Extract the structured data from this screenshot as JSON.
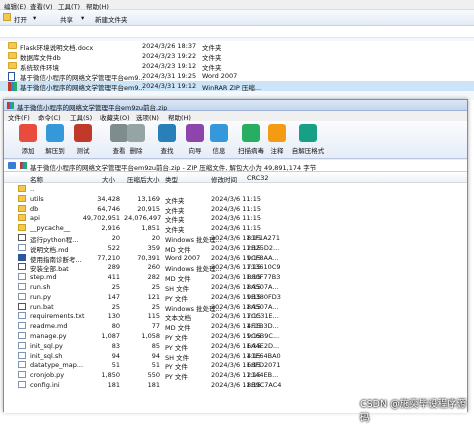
{
  "explorer": {
    "menu": [
      "编辑(E)",
      "查看(V)",
      "工具(T)",
      "帮助(H)"
    ],
    "toolbar": {
      "open": "打开",
      "share": "共享",
      "new_folder": "新建文件夹"
    },
    "rows": [
      {
        "name": "Flask环境说明文档.docx",
        "date": "2024/3/26 18:37",
        "type": "文件夹",
        "icon": "folder"
      },
      {
        "name": "数据库文件db",
        "date": "2024/3/23 19:22",
        "type": "文件夹",
        "icon": "folder"
      },
      {
        "name": "系统软件环境",
        "date": "2024/3/23 19:12",
        "type": "文件夹",
        "icon": "folder"
      },
      {
        "name": "基于微信小程序的网络文学管理平台em9...",
        "date": "2024/3/31 19:25",
        "type": "Word 2007",
        "icon": "word"
      },
      {
        "name": "基于微信小程序的网络文学管理平台em9...",
        "date": "2024/3/31 19:12",
        "type": "WinRAR ZIP 压缩...",
        "icon": "zip",
        "selected": true
      }
    ]
  },
  "rar": {
    "title": "基于微信小程序的网络文学管理平台em9zu前台.zip",
    "menu": [
      "文件(F)",
      "命令(C)",
      "工具(S)",
      "收藏夹(O)",
      "选项(N)",
      "帮助(H)"
    ],
    "toolbar": [
      {
        "label": "添加",
        "color": "#e74c3c"
      },
      {
        "label": "解压到",
        "color": "#3498db"
      },
      {
        "label": "测试",
        "color": "#c0392b"
      },
      {
        "label": "查看",
        "color": "#7f8c8d"
      },
      {
        "label": "删除",
        "color": "#95a5a6"
      },
      {
        "label": "查找",
        "color": "#2980b9"
      },
      {
        "label": "向导",
        "color": "#8e44ad"
      },
      {
        "label": "信息",
        "color": "#3498db"
      },
      {
        "label": "扫描病毒",
        "color": "#27ae60"
      },
      {
        "label": "注释",
        "color": "#f39c12"
      },
      {
        "label": "自解压格式",
        "color": "#16a085"
      }
    ],
    "path": "基于微信小程序的网络文学管理平台em9zu前台.zip - ZIP 压缩文件, 解包大小为 49,891,174 字节",
    "columns": {
      "name": "名称",
      "size": "大小",
      "packed": "压缩后大小",
      "type": "类型",
      "modified": "修改时间",
      "crc": "CRC32"
    },
    "rows": [
      {
        "name": "..",
        "size": "",
        "packed": "",
        "type": "",
        "modified": "",
        "crc": "",
        "icon": "folder"
      },
      {
        "name": "utils",
        "size": "34,428",
        "packed": "13,169",
        "type": "文件夹",
        "modified": "2024/3/6 11:15",
        "crc": "",
        "icon": "folder"
      },
      {
        "name": "db",
        "size": "64,746",
        "packed": "20,915",
        "type": "文件夹",
        "modified": "2024/3/6 11:15",
        "crc": "",
        "icon": "folder"
      },
      {
        "name": "api",
        "size": "49,702,951",
        "packed": "24,076,497",
        "type": "文件夹",
        "modified": "2024/3/6 11:15",
        "crc": "",
        "icon": "folder"
      },
      {
        "name": "__pycache__",
        "size": "2,916",
        "packed": "1,851",
        "type": "文件夹",
        "modified": "2024/3/6 11:15",
        "crc": "",
        "icon": "folder"
      },
      {
        "name": "运行python程...",
        "size": "20",
        "packed": "20",
        "type": "Windows 批处理...",
        "modified": "2024/3/6 11:15",
        "crc": "81F1A271",
        "icon": "bat"
      },
      {
        "name": "说明文档.md",
        "size": "522",
        "packed": "359",
        "type": "MD 文件",
        "modified": "2024/3/6 11:15",
        "crc": "2B25D2...",
        "icon": "doc"
      },
      {
        "name": "使用指南诊断考...",
        "size": "77,210",
        "packed": "70,391",
        "type": "Word 2007",
        "modified": "2024/3/6 11:15",
        "crc": "9CF8AA...",
        "icon": "word"
      },
      {
        "name": "安装全部.bat",
        "size": "289",
        "packed": "260",
        "type": "Windows 批处理...",
        "modified": "2024/3/6 11:15",
        "crc": "713610C9",
        "icon": "bat"
      },
      {
        "name": "step.md",
        "size": "411",
        "packed": "282",
        "type": "MD 文件",
        "modified": "2024/3/6 11:15",
        "crc": "B80F77B3",
        "icon": "doc"
      },
      {
        "name": "run.sh",
        "size": "25",
        "packed": "25",
        "type": "SH 文件",
        "modified": "2024/3/6 11:15",
        "crc": "8A507A...",
        "icon": "doc"
      },
      {
        "name": "run.py",
        "size": "147",
        "packed": "121",
        "type": "PY 文件",
        "modified": "2024/3/6 11:15",
        "crc": "9B380FD3",
        "icon": "doc"
      },
      {
        "name": "run.bat",
        "size": "25",
        "packed": "25",
        "type": "Windows 批处理...",
        "modified": "2024/3/6 11:15",
        "crc": "8A507A...",
        "icon": "bat"
      },
      {
        "name": "requirements.txt",
        "size": "130",
        "packed": "115",
        "type": "文本文档",
        "modified": "2024/3/6 11:15",
        "crc": "7CC31E...",
        "icon": "doc"
      },
      {
        "name": "readme.md",
        "size": "80",
        "packed": "77",
        "type": "MD 文件",
        "modified": "2024/3/6 11:15",
        "crc": "4F1B3D...",
        "icon": "doc"
      },
      {
        "name": "manage.py",
        "size": "1,087",
        "packed": "1,058",
        "type": "PY 文件",
        "modified": "2024/3/6 11:15",
        "crc": "9C6B9C...",
        "icon": "doc"
      },
      {
        "name": "init_sql.py",
        "size": "83",
        "packed": "85",
        "type": "PY 文件",
        "modified": "2024/3/6 11:15",
        "crc": "6A4E2D...",
        "icon": "doc"
      },
      {
        "name": "init_sql.sh",
        "size": "94",
        "packed": "94",
        "type": "SH 文件",
        "modified": "2024/3/6 11:15",
        "crc": "41E64BA0",
        "icon": "doc"
      },
      {
        "name": "datatype_map...",
        "size": "51",
        "packed": "51",
        "type": "PY 文件",
        "modified": "2024/3/6 11:15",
        "crc": "68FD2071",
        "icon": "doc"
      },
      {
        "name": "cronjob.py",
        "size": "1,850",
        "packed": "550",
        "type": "PY 文件",
        "modified": "2024/3/6 11:15",
        "crc": "2144EB...",
        "icon": "doc"
      },
      {
        "name": "config.ini",
        "size": "181",
        "packed": "181",
        "type": "",
        "modified": "2024/3/6 11:15",
        "crc": "8B9C7AC4",
        "icon": "doc"
      }
    ]
  },
  "watermark": "CSDN @施奕毕设程序源码"
}
